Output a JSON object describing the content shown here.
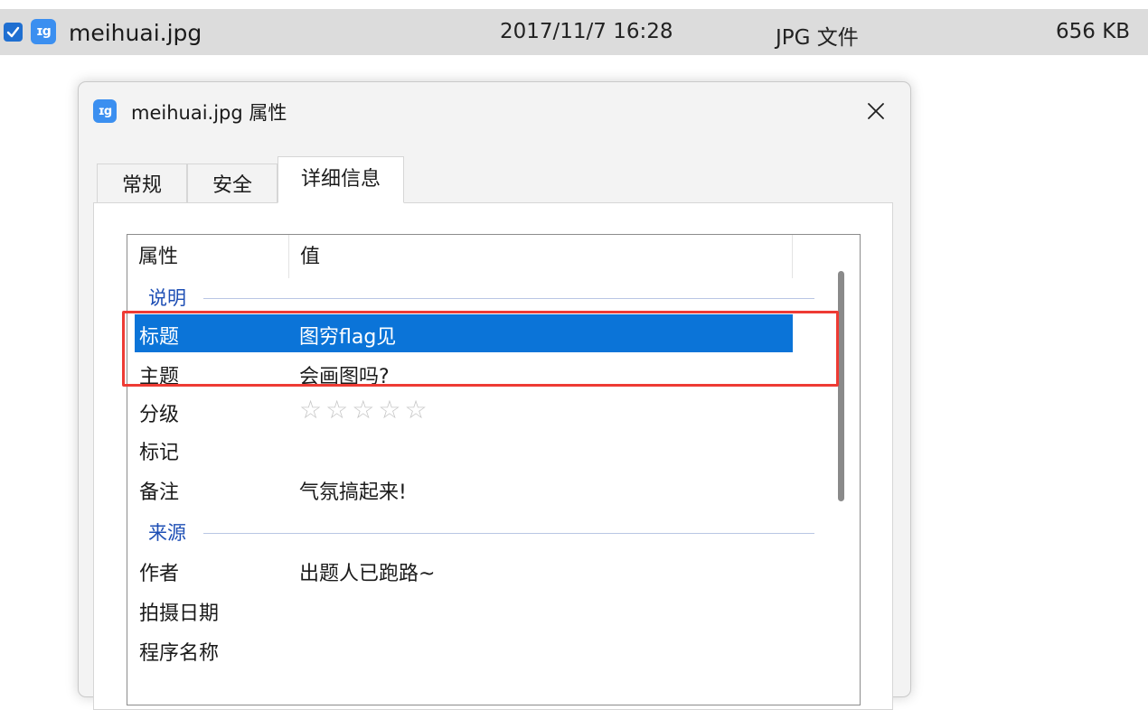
{
  "file_row": {
    "icon": "image-file-icon",
    "name": "meihuai.jpg",
    "date": "2017/11/7 16:28",
    "type": "JPG 文件",
    "size": "656 KB"
  },
  "dialog": {
    "title": "meihuai.jpg 属性",
    "tabs": [
      {
        "label": "常规"
      },
      {
        "label": "安全"
      },
      {
        "label": "详细信息"
      }
    ],
    "active_tab": "详细信息",
    "list": {
      "headers": [
        "属性",
        "值"
      ],
      "groups": [
        {
          "label": "说明",
          "rows": [
            {
              "name": "标题",
              "value": "图穷flag见",
              "selected": true
            },
            {
              "name": "主题",
              "value": "会画图吗?"
            },
            {
              "name": "分级",
              "value": "",
              "rating": 0,
              "rating_max": 5
            },
            {
              "name": "标记",
              "value": ""
            },
            {
              "name": "备注",
              "value": "气氛搞起来!"
            }
          ]
        },
        {
          "label": "来源",
          "rows": [
            {
              "name": "作者",
              "value": "出题人已跑路~"
            },
            {
              "name": "拍摄日期",
              "value": ""
            },
            {
              "name": "程序名称",
              "value": ""
            }
          ]
        }
      ]
    }
  },
  "colors": {
    "selection": "#0b74d8",
    "highlight_box": "#ee3b34",
    "group_label": "#1e4fb5",
    "file_row_bg": "#dcdcdc"
  }
}
